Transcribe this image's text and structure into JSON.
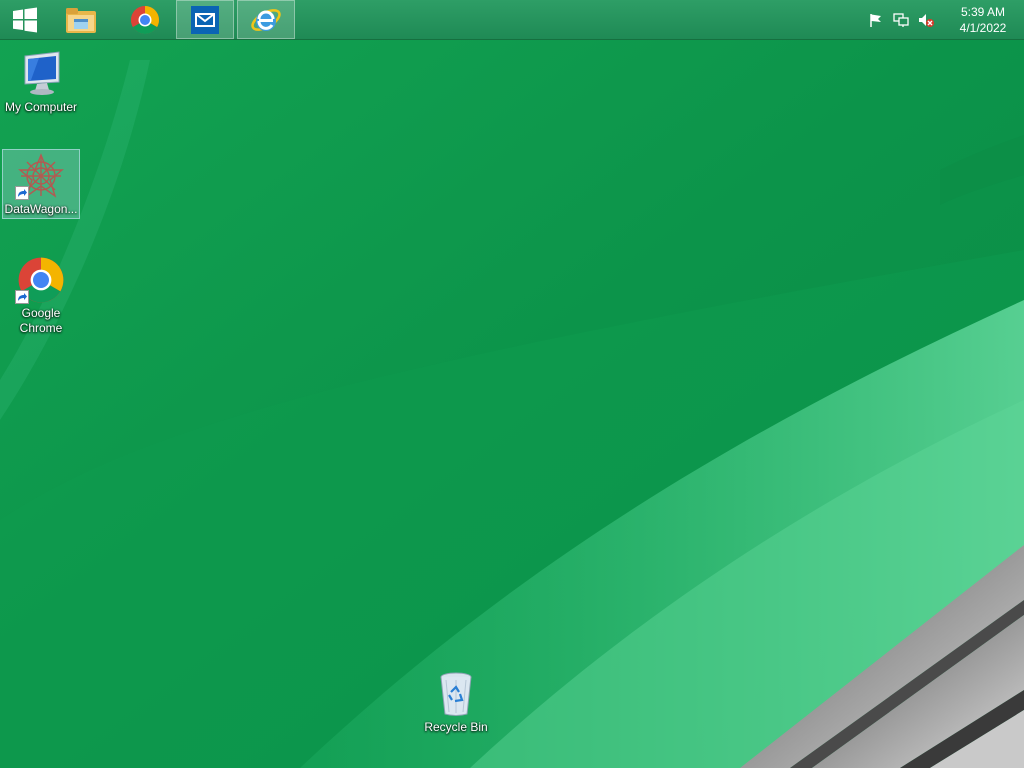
{
  "taskbar": {
    "pinned": [
      {
        "name": "start-button",
        "icon": "windows-logo-icon"
      },
      {
        "name": "file-explorer",
        "icon": "folder-icon"
      },
      {
        "name": "google-chrome",
        "icon": "chrome-icon"
      },
      {
        "name": "mail",
        "icon": "mail-icon",
        "active": true
      },
      {
        "name": "internet-explorer",
        "icon": "internet-explorer-icon",
        "active": true
      }
    ],
    "tray": {
      "icons": [
        "action-center-flag-icon",
        "network-icon",
        "volume-muted-icon"
      ],
      "time": "5:39 AM",
      "date": "4/1/2022"
    }
  },
  "desktop": {
    "icons": [
      {
        "label": "My Computer",
        "icon": "computer-icon"
      },
      {
        "label": "DataWagon...",
        "icon": "datawagon-icon",
        "selected": true,
        "shortcut": true
      },
      {
        "label": "Google Chrome",
        "icon": "chrome-icon",
        "shortcut": true
      },
      {
        "label": "Recycle Bin",
        "icon": "recycle-bin-icon"
      }
    ]
  },
  "colors": {
    "wallpaper_green": "#0f9a4e",
    "taskbar": "#23915b"
  }
}
